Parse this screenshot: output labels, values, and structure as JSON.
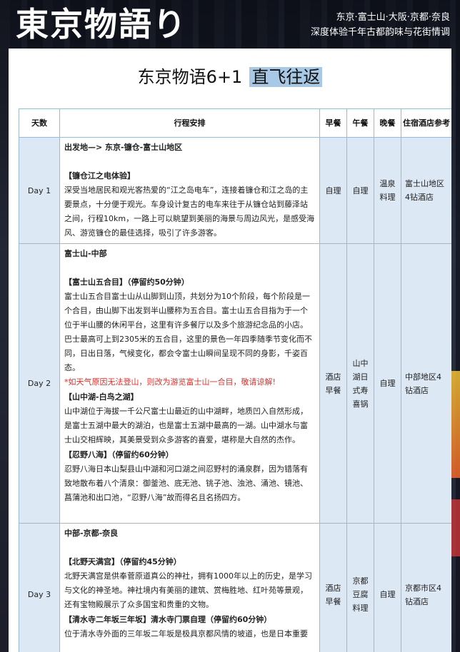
{
  "header": {
    "brand": "東京物語り",
    "tagline_line1": "东京·富士山·大阪·京都·奈良",
    "tagline_line2": "深度体验千年古都韵味与花街情调"
  },
  "document": {
    "title_main": "东京物语6+1",
    "title_highlight": "直飞往返"
  },
  "table": {
    "headers": {
      "day": "天数",
      "plan": "行程安排",
      "breakfast": "早餐",
      "lunch": "午餐",
      "dinner": "晚餐",
      "hotel": "住宿酒店参考"
    },
    "rows": [
      {
        "day": "Day 1",
        "route": "出发地—> 东京-镰仓-富士山地区",
        "sections": [
          {
            "heading": "【镰仓江之电体验】",
            "body": "深受当地居民和观光客热爱的“江之岛电车”，连接着镰仓和江之岛的主要景点，十分便于观光。车身设计复古的电车来往于从镰仓站到藤泽站之间，行程10km，一路上可以眺望到美丽的海景与周边风光，是感受海风、游览镰仓的最佳选择，吸引了许多游客。"
          }
        ],
        "breakfast": "自理",
        "lunch": "自理",
        "dinner": "温泉料理",
        "hotel": "富士山地区4钻酒店"
      },
      {
        "day": "Day 2",
        "route": "富士山-中部",
        "sections": [
          {
            "heading": "【富士山五合目】（停留约50分钟）",
            "body": "富士山五合目富士山从山脚到山顶，共划分为10个阶段，每个阶段是一个合目，由山脚下出发到半山腰称为五合目。富士山五合目指为于一个位于半山腰的休闲平台，这里有许多餐厅以及多个旅游纪念品的小店。巴士最高可上到2305米的五合目，这里的景色一年四季随季节变化而不同，日出日落，气候变化，都会令富士山瞬间呈现不同的身影，千姿百态。",
            "warn": "*如天气原因无法登山，则改为游览富士山一合目，敬请谅解!"
          },
          {
            "heading": "【山中湖-白鸟之湖】",
            "body": "山中湖位于海拔一千公尺富士山最近的山中湖畔，地质凹入自然形成，是富士五湖中最大的湖泊，也是富士五湖中最高的一湖。山中湖水与富士山交相辉映，其美景受到众多游客的喜爱，堪称是大自然的杰作。"
          },
          {
            "heading": "【忍野八海】（停留约60分钟）",
            "body": "忍野八海日本山梨县山中湖和河口湖之间忍野村的涌泉群，因为错落有致地散布着八个清泉：御釜池、底无池、铫子池、浊池、涌池、镜池、菖蒲池和出口池，“忍野八海”故而得名且名扬四方。"
          }
        ],
        "breakfast": "酒店早餐",
        "lunch": "山中湖日式寿喜锅",
        "dinner": "自理",
        "hotel": "中部地区4钻酒店"
      },
      {
        "day": "Day 3",
        "route": "中部-京都-奈良",
        "sections": [
          {
            "heading": "【北野天满宫】（停留约45分钟）",
            "body": "北野天满宫是供奉菅原道真公的神社，拥有1000年以上的历史，是学习与文化的神圣地。神社境内有美丽的建筑、赏梅胜地、红叶苑等景观，还有宝物殿展示了众多国宝和贵重的文物。"
          },
          {
            "heading": "【清水寺二年坂三年坂】清水寺门票自理（停留约60分钟）",
            "body": "位于清水寺外面的三年坂二年坂是极具京都风情的坡道，也是日本重要"
          }
        ],
        "breakfast": "酒店早餐",
        "lunch": "京都豆腐料理",
        "dinner": "自理",
        "hotel": "京都市区4钻酒店"
      }
    ]
  }
}
